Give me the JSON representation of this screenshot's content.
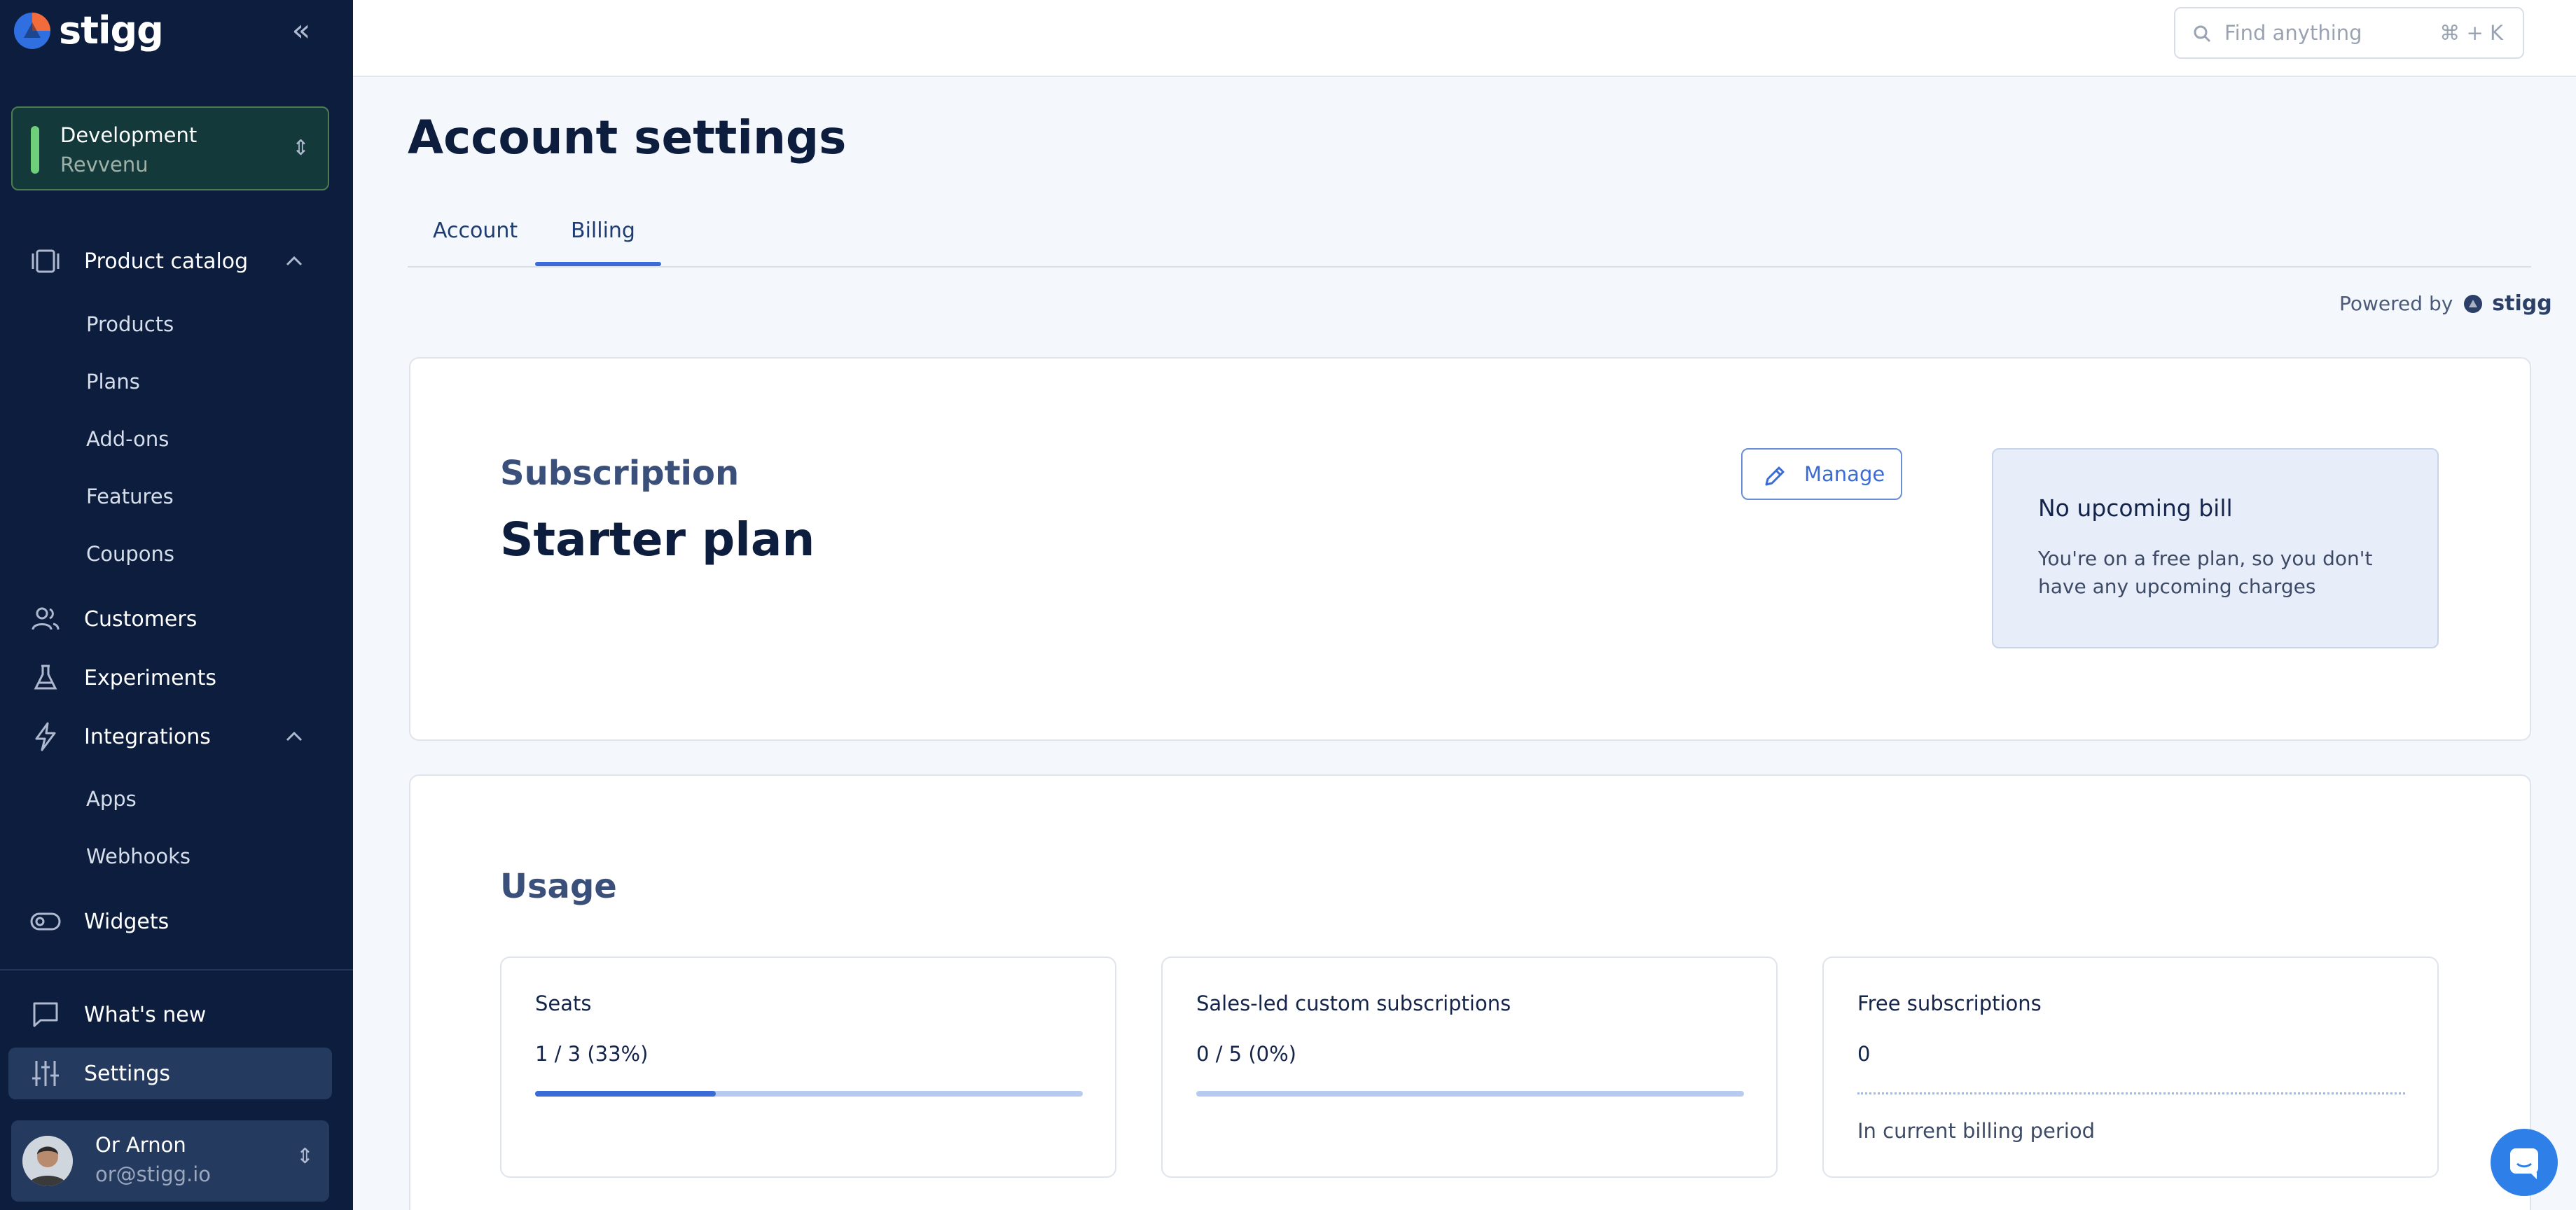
{
  "sidebar": {
    "logo_text": "stigg",
    "environment": {
      "name": "Development",
      "sub": "Revvenu"
    },
    "product_catalog": {
      "label": "Product catalog",
      "items": [
        "Products",
        "Plans",
        "Add-ons",
        "Features",
        "Coupons"
      ]
    },
    "customers": "Customers",
    "experiments": "Experiments",
    "integrations": {
      "label": "Integrations",
      "items": [
        "Apps",
        "Webhooks"
      ]
    },
    "widgets": "Widgets",
    "whats_new": "What's new",
    "settings": "Settings",
    "user": {
      "name": "Or Arnon",
      "email": "or@stigg.io"
    }
  },
  "topbar": {
    "search_placeholder": "Find anything",
    "search_shortcut": "⌘ + K"
  },
  "page": {
    "title": "Account settings",
    "tabs": [
      "Account",
      "Billing"
    ],
    "active_tab": "Billing",
    "powered_by": "Powered by",
    "powered_logo": "stigg"
  },
  "subscription": {
    "label": "Subscription",
    "plan": "Starter plan",
    "manage_label": "Manage",
    "bill_title": "No upcoming bill",
    "bill_text": "You're on a free plan, so you don't have any upcoming charges"
  },
  "usage": {
    "title": "Usage",
    "cards": [
      {
        "title": "Seats",
        "value": "1 / 3 (33%)",
        "progress": 0.33
      },
      {
        "title": "Sales-led custom subscriptions",
        "value": "0 / 5 (0%)",
        "progress": 0
      },
      {
        "title": "Free subscriptions",
        "value": "0",
        "note": "In current billing period"
      }
    ]
  },
  "colors": {
    "sidebar": "#0c1d3d",
    "accent": "#3a6bd6",
    "env_indicator": "#6fcf7b"
  }
}
